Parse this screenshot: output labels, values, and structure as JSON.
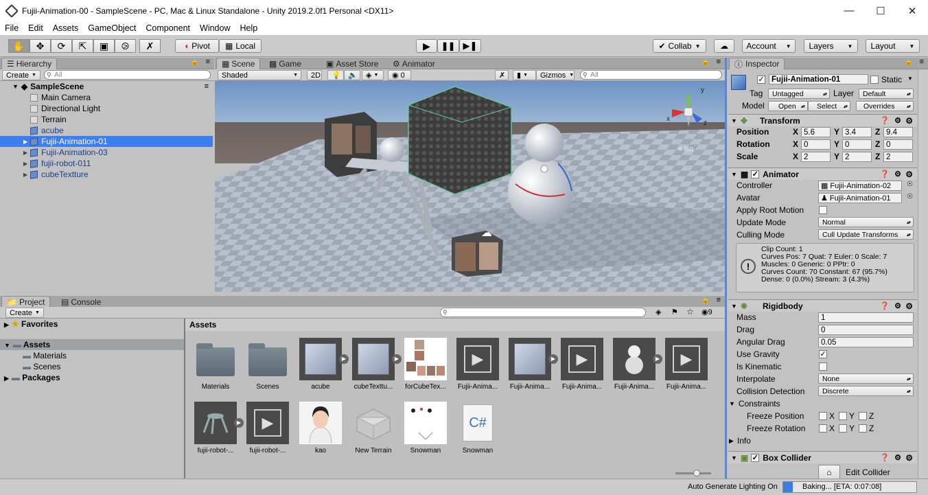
{
  "window": {
    "title": "Fujii-Animation-00 - SampleScene - PC, Mac & Linux Standalone - Unity 2019.2.0f1 Personal <DX11>"
  },
  "menu": [
    "File",
    "Edit",
    "Assets",
    "GameObject",
    "Component",
    "Window",
    "Help"
  ],
  "toolbar": {
    "pivot": "Pivot",
    "local": "Local",
    "collab": "Collab",
    "account": "Account",
    "layers": "Layers",
    "layout": "Layout"
  },
  "hierarchy": {
    "tab": "Hierarchy",
    "create": "Create",
    "search_placeholder": "All",
    "scene": "SampleScene",
    "items": [
      {
        "label": "Main Camera",
        "selected": false,
        "prefab": false,
        "arrow": false
      },
      {
        "label": "Directional Light",
        "selected": false,
        "prefab": false,
        "arrow": false
      },
      {
        "label": "Terrain",
        "selected": false,
        "prefab": false,
        "arrow": false
      },
      {
        "label": "acube",
        "selected": false,
        "prefab": true,
        "arrow": false
      },
      {
        "label": "Fujii-Animation-01",
        "selected": true,
        "prefab": true,
        "arrow": true
      },
      {
        "label": "Fujii-Animation-03",
        "selected": false,
        "prefab": true,
        "arrow": true
      },
      {
        "label": "fujii-robot-011",
        "selected": false,
        "prefab": true,
        "arrow": true
      },
      {
        "label": "cubeTextture",
        "selected": false,
        "prefab": true,
        "arrow": true
      }
    ]
  },
  "scene_view": {
    "tabs": [
      "Scene",
      "Game",
      "Asset Store",
      "Animator"
    ],
    "shading": "Shaded",
    "mode2d": "2D",
    "hidden_count": "0",
    "gizmos": "Gizmos",
    "search_placeholder": "All",
    "iso": "Iso",
    "gizmo_axes": {
      "x": "x",
      "y": "y",
      "z": "z"
    }
  },
  "project": {
    "tabs": [
      "Project",
      "Console"
    ],
    "create": "Create",
    "hidden_count": "9",
    "tree": {
      "favorites": "Favorites",
      "assets": "Assets",
      "materials": "Materials",
      "scenes": "Scenes",
      "packages": "Packages"
    },
    "breadcrumb": "Assets",
    "assets": [
      {
        "label": "Materials",
        "kind": "folder"
      },
      {
        "label": "Scenes",
        "kind": "folder"
      },
      {
        "label": "acube",
        "kind": "prefab"
      },
      {
        "label": "cubeTexttu...",
        "kind": "prefab"
      },
      {
        "label": "forCubeTex...",
        "kind": "image"
      },
      {
        "label": "Fujii-Anima...",
        "kind": "controller"
      },
      {
        "label": "Fujii-Anima...",
        "kind": "prefab"
      },
      {
        "label": "Fujii-Anima...",
        "kind": "controller"
      },
      {
        "label": "Fujii-Anima...",
        "kind": "snowprefab"
      },
      {
        "label": "Fujii-Anima...",
        "kind": "controller"
      },
      {
        "label": "fujii-robot-...",
        "kind": "robot"
      },
      {
        "label": "fujii-robot-...",
        "kind": "controller"
      },
      {
        "label": "kao",
        "kind": "photo"
      },
      {
        "label": "New Terrain",
        "kind": "terrain"
      },
      {
        "label": "Snowman",
        "kind": "snowman"
      },
      {
        "label": "Snowman",
        "kind": "script",
        "glyph": "C#"
      }
    ]
  },
  "inspector": {
    "tab": "Inspector",
    "object_name": "Fujii-Animation-01",
    "static": "Static",
    "tag_label": "Tag",
    "tag": "Untagged",
    "layer_label": "Layer",
    "layer": "Default",
    "model_label": "Model",
    "open": "Open",
    "select": "Select",
    "overrides": "Overrides",
    "transform": {
      "title": "Transform",
      "position": "Position",
      "rotation": "Rotation",
      "scale": "Scale",
      "pos": [
        "5.6",
        "3.4",
        "9.4"
      ],
      "rot": [
        "0",
        "0",
        "0"
      ],
      "scl": [
        "2",
        "2",
        "2"
      ],
      "axes": [
        "X",
        "Y",
        "Z"
      ]
    },
    "animator": {
      "title": "Animator",
      "controller_label": "Controller",
      "controller": "Fujii-Animation-02",
      "avatar_label": "Avatar",
      "avatar": "Fujii-Animation-01",
      "apply_root": "Apply Root Motion",
      "update_label": "Update Mode",
      "update": "Normal",
      "culling_label": "Culling Mode",
      "culling": "Cull Update Transforms",
      "info": [
        "Clip Count: 1",
        "Curves Pos: 7 Quat: 7 Euler: 0 Scale: 7",
        "Muscles: 0 Generic: 0 PPtr: 0",
        "Curves Count: 70 Constant: 67 (95.7%)",
        "Dense: 0 (0.0%) Stream: 3 (4.3%)"
      ]
    },
    "rigidbody": {
      "title": "Rigidbody",
      "mass_label": "Mass",
      "mass": "1",
      "drag_label": "Drag",
      "drag": "0",
      "angdrag_label": "Angular Drag",
      "angdrag": "0.05",
      "gravity_label": "Use Gravity",
      "kinematic_label": "Is Kinematic",
      "interp_label": "Interpolate",
      "interp": "None",
      "coll_label": "Collision Detection",
      "coll": "Discrete",
      "constraints": "Constraints",
      "freeze_pos": "Freeze Position",
      "freeze_rot": "Freeze Rotation",
      "info": "Info"
    },
    "boxcollider": {
      "title": "Box Collider",
      "edit": "Edit Collider"
    }
  },
  "status": {
    "lighting": "Auto Generate Lighting On",
    "baking": "Baking... [ETA: 0:07:08]"
  }
}
